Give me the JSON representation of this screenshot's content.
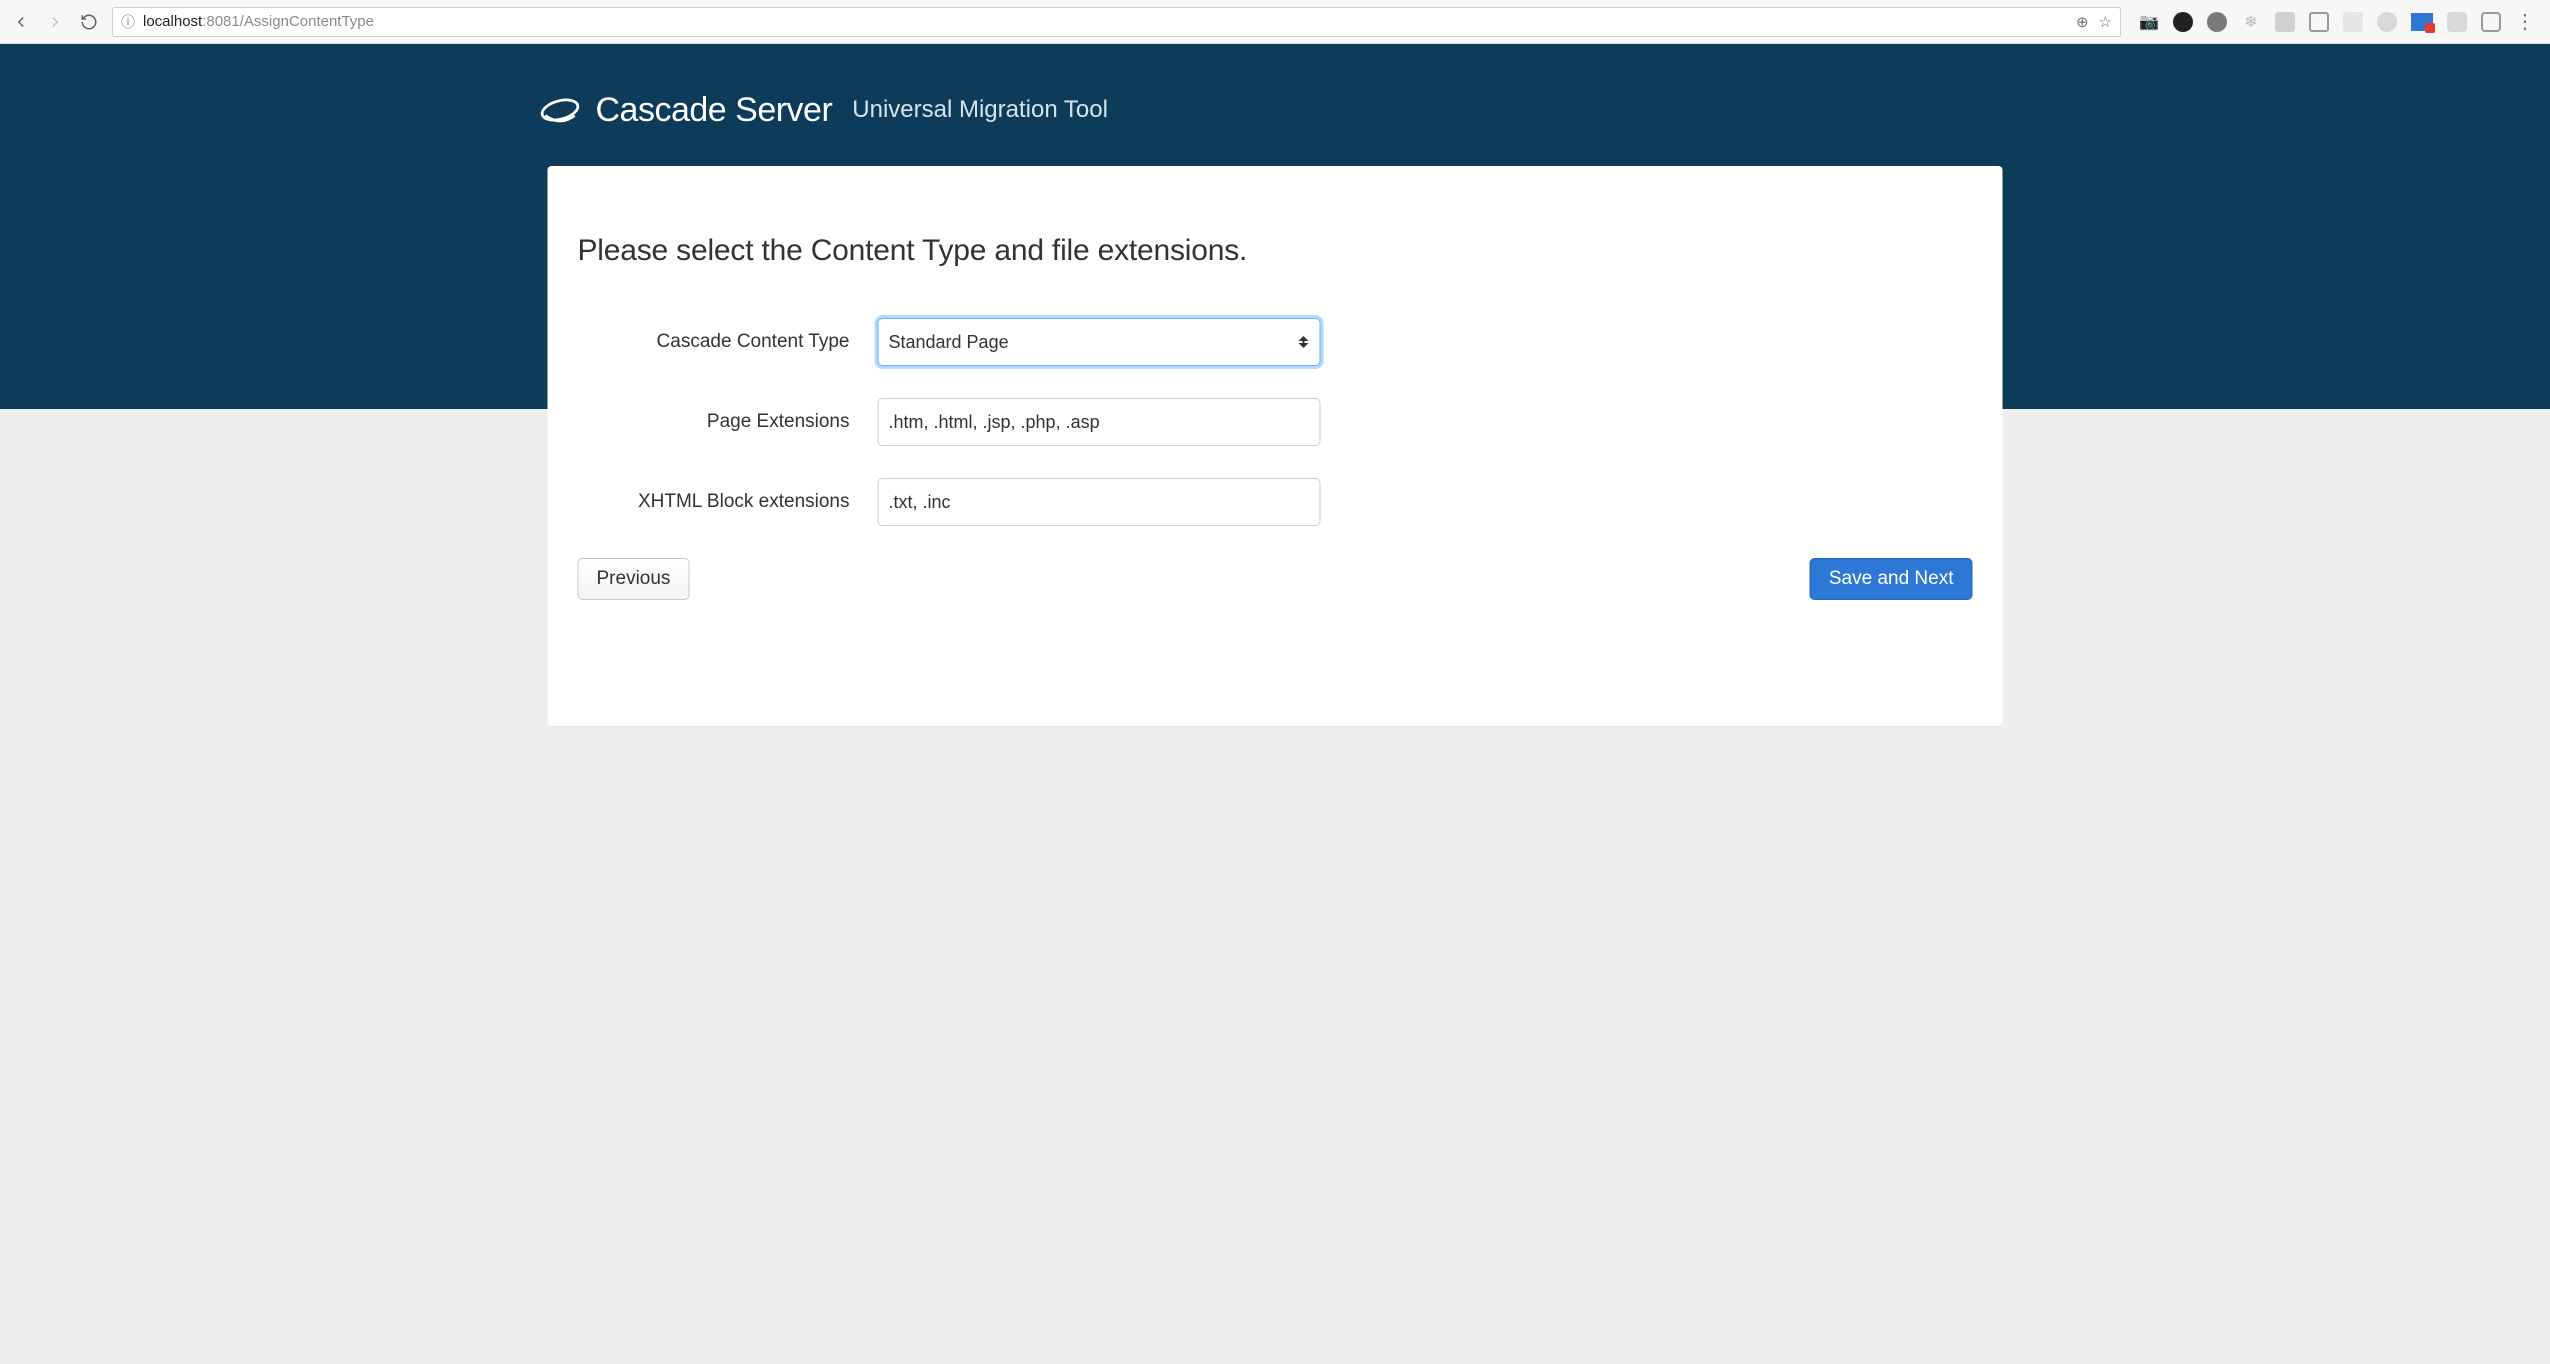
{
  "browser": {
    "url_host": "localhost",
    "url_rest": ":8081/AssignContentType"
  },
  "header": {
    "title": "Cascade Server",
    "subtitle": "Universal Migration Tool"
  },
  "page": {
    "heading": "Please select the Content Type and file extensions."
  },
  "form": {
    "content_type_label": "Cascade Content Type",
    "content_type_value": "Standard Page",
    "page_ext_label": "Page Extensions",
    "page_ext_value": ".htm, .html, .jsp, .php, .asp",
    "xhtml_ext_label": "XHTML Block extensions",
    "xhtml_ext_value": ".txt, .inc"
  },
  "buttons": {
    "previous": "Previous",
    "save_next": "Save and Next"
  }
}
